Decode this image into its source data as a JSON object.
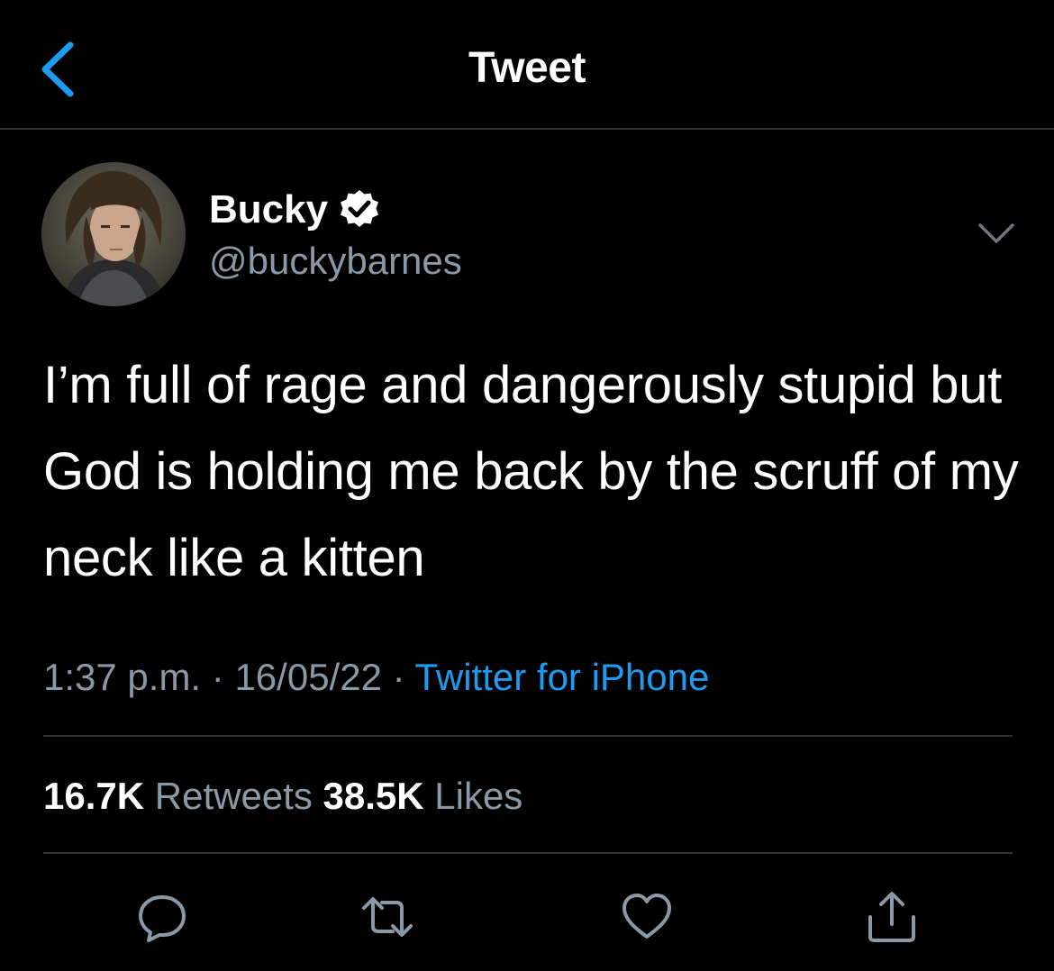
{
  "header": {
    "title": "Tweet",
    "back_icon": "chevron-left-icon",
    "accent_color": "#1d9bf0"
  },
  "author": {
    "name": "Bucky",
    "handle": "@buckybarnes",
    "verified": true,
    "verified_icon": "verified-badge-icon",
    "menu_icon": "chevron-down-icon"
  },
  "tweet": {
    "text": "I’m full of rage and dangerously stupid but God is holding me back by the scruff of my neck like a kitten",
    "time": "1:37 p.m.",
    "date": "16/05/22",
    "separator": "·",
    "source": "Twitter for iPhone"
  },
  "stats": {
    "retweets_count": "16.7K",
    "retweets_label": "Retweets",
    "likes_count": "38.5K",
    "likes_label": "Likes"
  },
  "actions": [
    {
      "icon": "reply-icon"
    },
    {
      "icon": "retweet-icon"
    },
    {
      "icon": "like-icon"
    },
    {
      "icon": "share-icon"
    }
  ],
  "colors": {
    "background": "#000000",
    "text": "#ffffff",
    "muted": "#8b98a5",
    "divider": "#2f3336",
    "link": "#1d9bf0"
  }
}
